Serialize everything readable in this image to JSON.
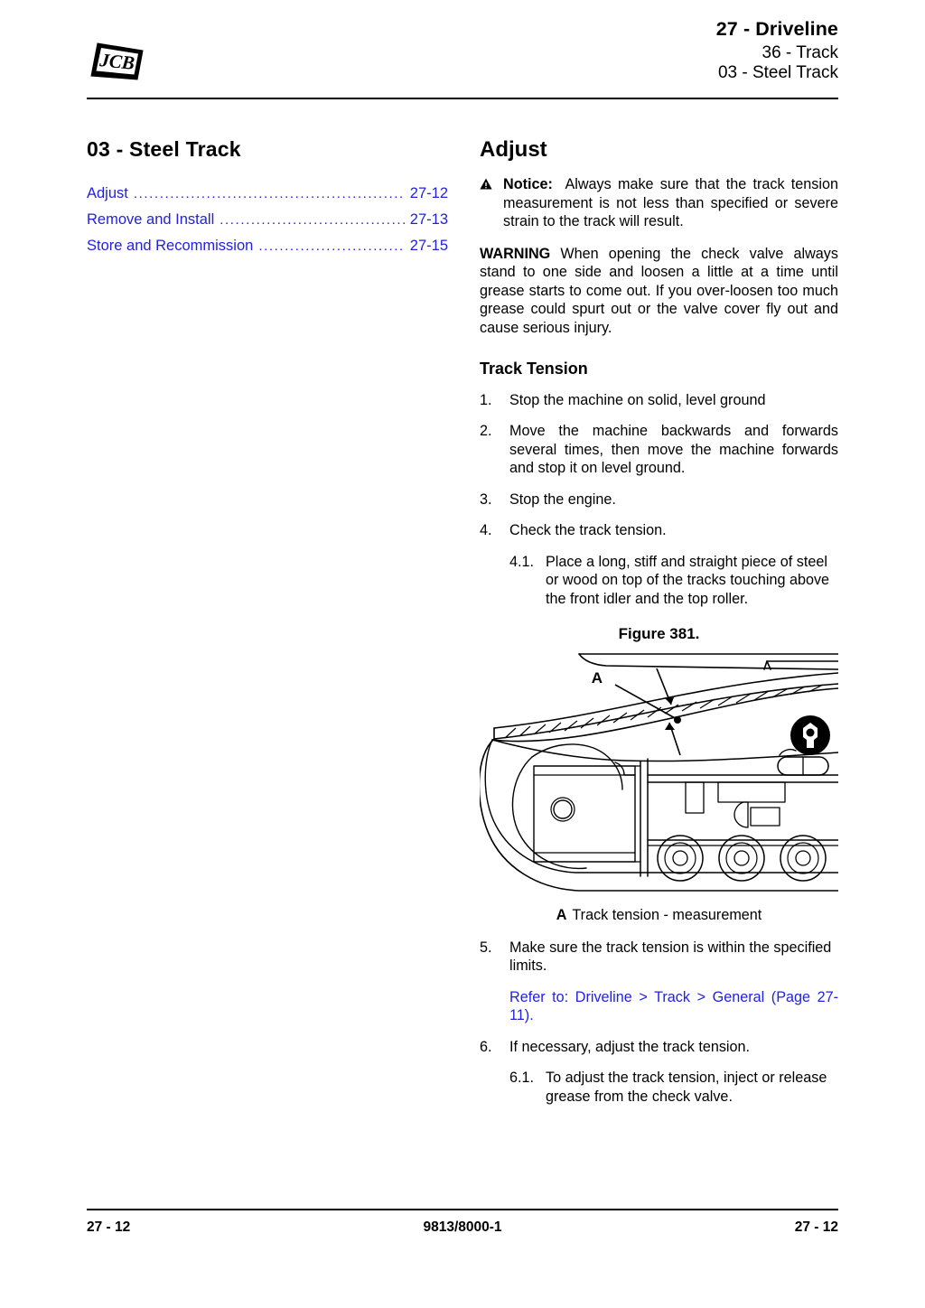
{
  "header": {
    "logo_text": "JCB",
    "logo_icon": "jcb-logo",
    "title": "27 - Driveline",
    "subtitle1": "36 - Track",
    "subtitle2": "03 - Steel Track"
  },
  "left_column": {
    "section_title": "03 - Steel Track",
    "toc": [
      {
        "label": "Adjust",
        "dots": "................................................................",
        "page": "27-12"
      },
      {
        "label": "Remove and Install",
        "dots": "................................................................",
        "page": "27-13"
      },
      {
        "label": "Store and Recommission",
        "dots": "................................................................",
        "page": "27-15"
      }
    ]
  },
  "right_column": {
    "title": "Adjust",
    "notice": {
      "icon": "warning-triangle-icon",
      "label": "Notice:",
      "text": "Always make sure that the track tension measurement is not less than specified or severe strain to the track will result."
    },
    "warning": {
      "label": "WARNING",
      "text": "When opening the check valve always stand to one side and loosen a little at a time until grease starts to come out. If you over-loosen too much grease could spurt out or the valve cover fly out and cause serious injury."
    },
    "subsection_title": "Track Tension",
    "steps": [
      {
        "num": "1.",
        "text": "Stop the machine on solid, level ground",
        "justify": false
      },
      {
        "num": "2.",
        "text": "Move the machine backwards and forwards several times, then move the machine forwards and stop it on level ground.",
        "justify": true
      },
      {
        "num": "3.",
        "text": "Stop the engine.",
        "justify": false
      },
      {
        "num": "4.",
        "text": "Check the track tension.",
        "justify": false
      }
    ],
    "substep_4_1": {
      "num": "4.1.",
      "text": "Place a long, stiff and straight piece of steel or wood on top of the tracks touching above the front idler and the top roller."
    },
    "figure": {
      "title": "Figure 381.",
      "callout_label": "A",
      "caption_key": "A",
      "caption_text": "Track tension - measurement"
    },
    "step_5": {
      "num": "5.",
      "text": "Make sure the track tension is within the specified limits."
    },
    "reference_link": "Refer to: Driveline > Track > General (Page 27-11).",
    "step_6": {
      "num": "6.",
      "text": "If necessary, adjust the track tension."
    },
    "substep_6_1": {
      "num": "6.1.",
      "text": "To adjust the track tension, inject or release grease from the check valve."
    }
  },
  "footer": {
    "left": "27 - 12",
    "center": "9813/8000-1",
    "right": "27 - 12"
  },
  "colors": {
    "link_blue": "#2222dd",
    "text_black": "#000000"
  }
}
